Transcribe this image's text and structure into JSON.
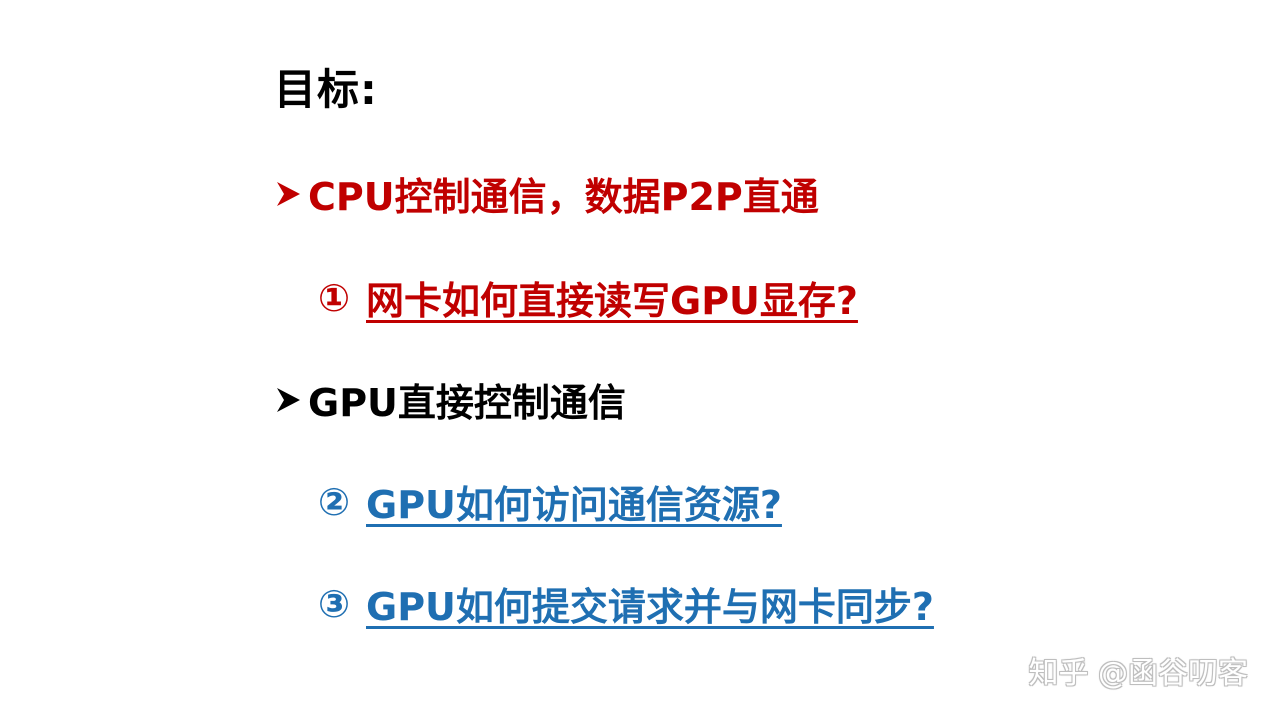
{
  "slide": {
    "title": "目标:",
    "bullets": [
      {
        "text": "CPU控制通信，数据P2P直通",
        "color": "#c00000",
        "sub": {
          "marker": "①",
          "text": "网卡如何直接读写GPU显存?"
        }
      },
      {
        "text": "GPU直接控制通信",
        "color": "#000000",
        "subs": [
          {
            "marker": "②",
            "text": "GPU如何访问通信资源?"
          },
          {
            "marker": "③",
            "text": "GPU如何提交请求并与网卡同步?"
          }
        ]
      }
    ],
    "sub_color_red": "#c00000",
    "sub_color_blue": "#1f6fb2",
    "bullet_icon": "arrow-bullet-icon"
  },
  "watermark": "知乎 @函谷叨客"
}
